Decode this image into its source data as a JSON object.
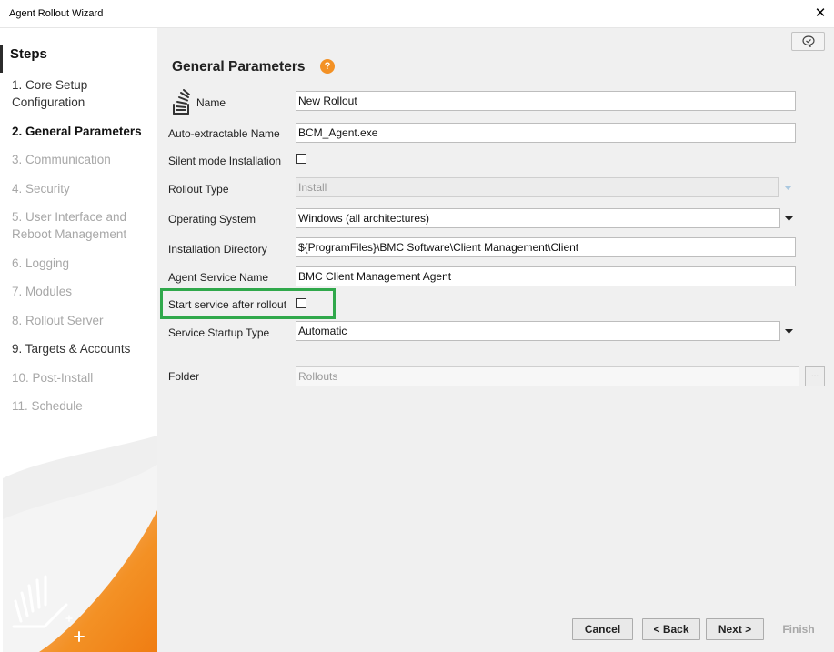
{
  "window": {
    "title": "Agent Rollout Wizard",
    "close_glyph": "✕"
  },
  "sidebar": {
    "title": "Steps",
    "steps": [
      {
        "label": "1. Core Setup Configuration",
        "state": "done"
      },
      {
        "label": "2. General Parameters",
        "state": "active"
      },
      {
        "label": "3. Communication",
        "state": "pending"
      },
      {
        "label": "4. Security",
        "state": "pending"
      },
      {
        "label": "5. User Interface and Reboot Management",
        "state": "pending"
      },
      {
        "label": "6. Logging",
        "state": "pending"
      },
      {
        "label": "7. Modules",
        "state": "pending"
      },
      {
        "label": "8. Rollout Server",
        "state": "pending"
      },
      {
        "label": "9. Targets & Accounts",
        "state": "done"
      },
      {
        "label": "10. Post-Install",
        "state": "pending"
      },
      {
        "label": "11. Schedule",
        "state": "pending"
      }
    ]
  },
  "main": {
    "heading": "General Parameters",
    "help_icon": "?",
    "fields": {
      "name": {
        "label": "Name",
        "value": "New Rollout"
      },
      "auto_extractable_name": {
        "label": "Auto-extractable Name",
        "value": "BCM_Agent.exe"
      },
      "silent_mode": {
        "label": "Silent mode Installation",
        "checked": false
      },
      "rollout_type": {
        "label": "Rollout Type",
        "value": "Install",
        "disabled": true
      },
      "operating_system": {
        "label": "Operating System",
        "value": "Windows (all architectures)"
      },
      "installation_directory": {
        "label": "Installation Directory",
        "value": "${ProgramFiles}\\BMC Software\\Client Management\\Client"
      },
      "agent_service_name": {
        "label": "Agent Service Name",
        "value": "BMC Client Management Agent"
      },
      "start_service": {
        "label": "Start service after rollout",
        "checked": false
      },
      "service_startup_type": {
        "label": "Service Startup Type",
        "value": "Automatic"
      },
      "folder": {
        "label": "Folder",
        "value": "Rollouts",
        "browse": "..."
      }
    }
  },
  "buttons": {
    "cancel": "Cancel",
    "back": "< Back",
    "next": "Next >",
    "finish": "Finish"
  },
  "colors": {
    "accent": "#f39125",
    "highlight": "#30a84b",
    "panel": "#f0f0f0"
  },
  "icons": [
    "close-icon",
    "feedback-icon",
    "help-icon",
    "name-stack-icon",
    "chevron-down-icon",
    "wizard-logo-icon"
  ]
}
